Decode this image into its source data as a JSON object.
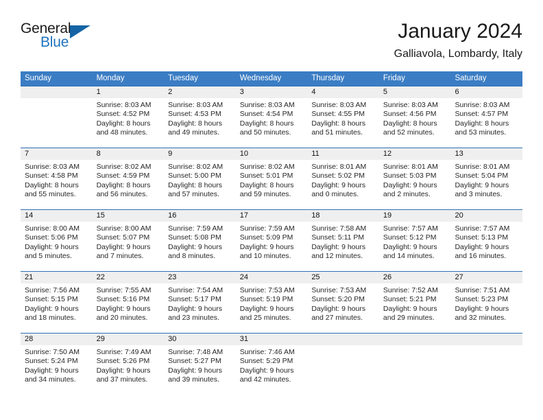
{
  "brand": {
    "name_part1": "General",
    "name_part2": "Blue",
    "accent_color": "#1464a5"
  },
  "header": {
    "title": "January 2024",
    "subtitle": "Galliavola, Lombardy, Italy"
  },
  "theme": {
    "header_bar_color": "#3b7dc4",
    "daynum_strip_color": "#efefef",
    "week_divider_color": "#2f6fb5"
  },
  "weekdays": [
    "Sunday",
    "Monday",
    "Tuesday",
    "Wednesday",
    "Thursday",
    "Friday",
    "Saturday"
  ],
  "weeks": [
    {
      "daynums": [
        "",
        "1",
        "2",
        "3",
        "4",
        "5",
        "6"
      ],
      "details": [
        {
          "l1": "",
          "l2": "",
          "l3": "",
          "l4": ""
        },
        {
          "l1": "Sunrise: 8:03 AM",
          "l2": "Sunset: 4:52 PM",
          "l3": "Daylight: 8 hours",
          "l4": "and 48 minutes."
        },
        {
          "l1": "Sunrise: 8:03 AM",
          "l2": "Sunset: 4:53 PM",
          "l3": "Daylight: 8 hours",
          "l4": "and 49 minutes."
        },
        {
          "l1": "Sunrise: 8:03 AM",
          "l2": "Sunset: 4:54 PM",
          "l3": "Daylight: 8 hours",
          "l4": "and 50 minutes."
        },
        {
          "l1": "Sunrise: 8:03 AM",
          "l2": "Sunset: 4:55 PM",
          "l3": "Daylight: 8 hours",
          "l4": "and 51 minutes."
        },
        {
          "l1": "Sunrise: 8:03 AM",
          "l2": "Sunset: 4:56 PM",
          "l3": "Daylight: 8 hours",
          "l4": "and 52 minutes."
        },
        {
          "l1": "Sunrise: 8:03 AM",
          "l2": "Sunset: 4:57 PM",
          "l3": "Daylight: 8 hours",
          "l4": "and 53 minutes."
        }
      ]
    },
    {
      "daynums": [
        "7",
        "8",
        "9",
        "10",
        "11",
        "12",
        "13"
      ],
      "details": [
        {
          "l1": "Sunrise: 8:03 AM",
          "l2": "Sunset: 4:58 PM",
          "l3": "Daylight: 8 hours",
          "l4": "and 55 minutes."
        },
        {
          "l1": "Sunrise: 8:02 AM",
          "l2": "Sunset: 4:59 PM",
          "l3": "Daylight: 8 hours",
          "l4": "and 56 minutes."
        },
        {
          "l1": "Sunrise: 8:02 AM",
          "l2": "Sunset: 5:00 PM",
          "l3": "Daylight: 8 hours",
          "l4": "and 57 minutes."
        },
        {
          "l1": "Sunrise: 8:02 AM",
          "l2": "Sunset: 5:01 PM",
          "l3": "Daylight: 8 hours",
          "l4": "and 59 minutes."
        },
        {
          "l1": "Sunrise: 8:01 AM",
          "l2": "Sunset: 5:02 PM",
          "l3": "Daylight: 9 hours",
          "l4": "and 0 minutes."
        },
        {
          "l1": "Sunrise: 8:01 AM",
          "l2": "Sunset: 5:03 PM",
          "l3": "Daylight: 9 hours",
          "l4": "and 2 minutes."
        },
        {
          "l1": "Sunrise: 8:01 AM",
          "l2": "Sunset: 5:04 PM",
          "l3": "Daylight: 9 hours",
          "l4": "and 3 minutes."
        }
      ]
    },
    {
      "daynums": [
        "14",
        "15",
        "16",
        "17",
        "18",
        "19",
        "20"
      ],
      "details": [
        {
          "l1": "Sunrise: 8:00 AM",
          "l2": "Sunset: 5:06 PM",
          "l3": "Daylight: 9 hours",
          "l4": "and 5 minutes."
        },
        {
          "l1": "Sunrise: 8:00 AM",
          "l2": "Sunset: 5:07 PM",
          "l3": "Daylight: 9 hours",
          "l4": "and 7 minutes."
        },
        {
          "l1": "Sunrise: 7:59 AM",
          "l2": "Sunset: 5:08 PM",
          "l3": "Daylight: 9 hours",
          "l4": "and 8 minutes."
        },
        {
          "l1": "Sunrise: 7:59 AM",
          "l2": "Sunset: 5:09 PM",
          "l3": "Daylight: 9 hours",
          "l4": "and 10 minutes."
        },
        {
          "l1": "Sunrise: 7:58 AM",
          "l2": "Sunset: 5:11 PM",
          "l3": "Daylight: 9 hours",
          "l4": "and 12 minutes."
        },
        {
          "l1": "Sunrise: 7:57 AM",
          "l2": "Sunset: 5:12 PM",
          "l3": "Daylight: 9 hours",
          "l4": "and 14 minutes."
        },
        {
          "l1": "Sunrise: 7:57 AM",
          "l2": "Sunset: 5:13 PM",
          "l3": "Daylight: 9 hours",
          "l4": "and 16 minutes."
        }
      ]
    },
    {
      "daynums": [
        "21",
        "22",
        "23",
        "24",
        "25",
        "26",
        "27"
      ],
      "details": [
        {
          "l1": "Sunrise: 7:56 AM",
          "l2": "Sunset: 5:15 PM",
          "l3": "Daylight: 9 hours",
          "l4": "and 18 minutes."
        },
        {
          "l1": "Sunrise: 7:55 AM",
          "l2": "Sunset: 5:16 PM",
          "l3": "Daylight: 9 hours",
          "l4": "and 20 minutes."
        },
        {
          "l1": "Sunrise: 7:54 AM",
          "l2": "Sunset: 5:17 PM",
          "l3": "Daylight: 9 hours",
          "l4": "and 23 minutes."
        },
        {
          "l1": "Sunrise: 7:53 AM",
          "l2": "Sunset: 5:19 PM",
          "l3": "Daylight: 9 hours",
          "l4": "and 25 minutes."
        },
        {
          "l1": "Sunrise: 7:53 AM",
          "l2": "Sunset: 5:20 PM",
          "l3": "Daylight: 9 hours",
          "l4": "and 27 minutes."
        },
        {
          "l1": "Sunrise: 7:52 AM",
          "l2": "Sunset: 5:21 PM",
          "l3": "Daylight: 9 hours",
          "l4": "and 29 minutes."
        },
        {
          "l1": "Sunrise: 7:51 AM",
          "l2": "Sunset: 5:23 PM",
          "l3": "Daylight: 9 hours",
          "l4": "and 32 minutes."
        }
      ]
    },
    {
      "daynums": [
        "28",
        "29",
        "30",
        "31",
        "",
        "",
        ""
      ],
      "details": [
        {
          "l1": "Sunrise: 7:50 AM",
          "l2": "Sunset: 5:24 PM",
          "l3": "Daylight: 9 hours",
          "l4": "and 34 minutes."
        },
        {
          "l1": "Sunrise: 7:49 AM",
          "l2": "Sunset: 5:26 PM",
          "l3": "Daylight: 9 hours",
          "l4": "and 37 minutes."
        },
        {
          "l1": "Sunrise: 7:48 AM",
          "l2": "Sunset: 5:27 PM",
          "l3": "Daylight: 9 hours",
          "l4": "and 39 minutes."
        },
        {
          "l1": "Sunrise: 7:46 AM",
          "l2": "Sunset: 5:29 PM",
          "l3": "Daylight: 9 hours",
          "l4": "and 42 minutes."
        },
        {
          "l1": "",
          "l2": "",
          "l3": "",
          "l4": ""
        },
        {
          "l1": "",
          "l2": "",
          "l3": "",
          "l4": ""
        },
        {
          "l1": "",
          "l2": "",
          "l3": "",
          "l4": ""
        }
      ]
    }
  ]
}
